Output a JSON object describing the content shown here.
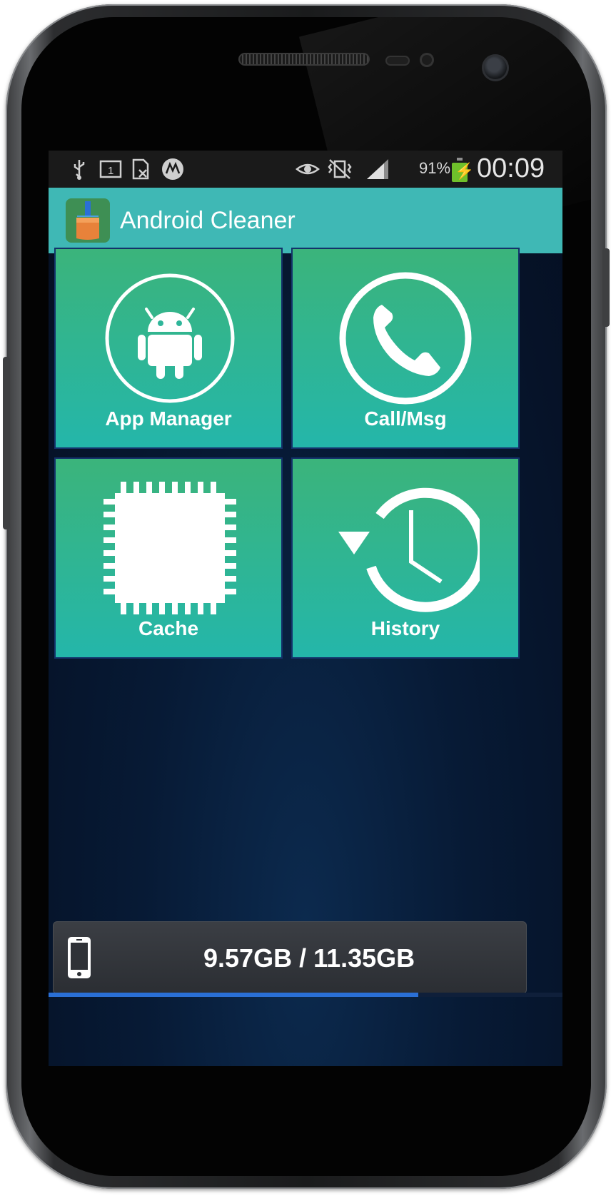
{
  "app": {
    "title": "Android Cleaner"
  },
  "status_bar": {
    "battery_percent": "91%",
    "clock": "00:09",
    "battery_level": 0.91,
    "icons": [
      "usb-icon",
      "sim-card-icon",
      "sim-blocked-icon",
      "motorola-icon",
      "eye-icon",
      "vibrate-off-icon",
      "signal-icon",
      "battery-charging-icon"
    ]
  },
  "tiles": [
    {
      "label": "App Manager",
      "icon": "android-icon"
    },
    {
      "label": "Call/Msg",
      "icon": "phone-icon"
    },
    {
      "label": "Cache",
      "icon": "chip-icon"
    },
    {
      "label": "History",
      "icon": "history-clock-icon"
    }
  ],
  "storage": {
    "text": "9.57GB / 11.35GB",
    "used_fraction": 0.72,
    "icon": "smartphone-icon"
  },
  "colors": {
    "accent": "#3fb8b5",
    "tile_top": "#3bb47b",
    "tile_bottom": "#24b6aa",
    "progress": "#2a6fd6"
  }
}
